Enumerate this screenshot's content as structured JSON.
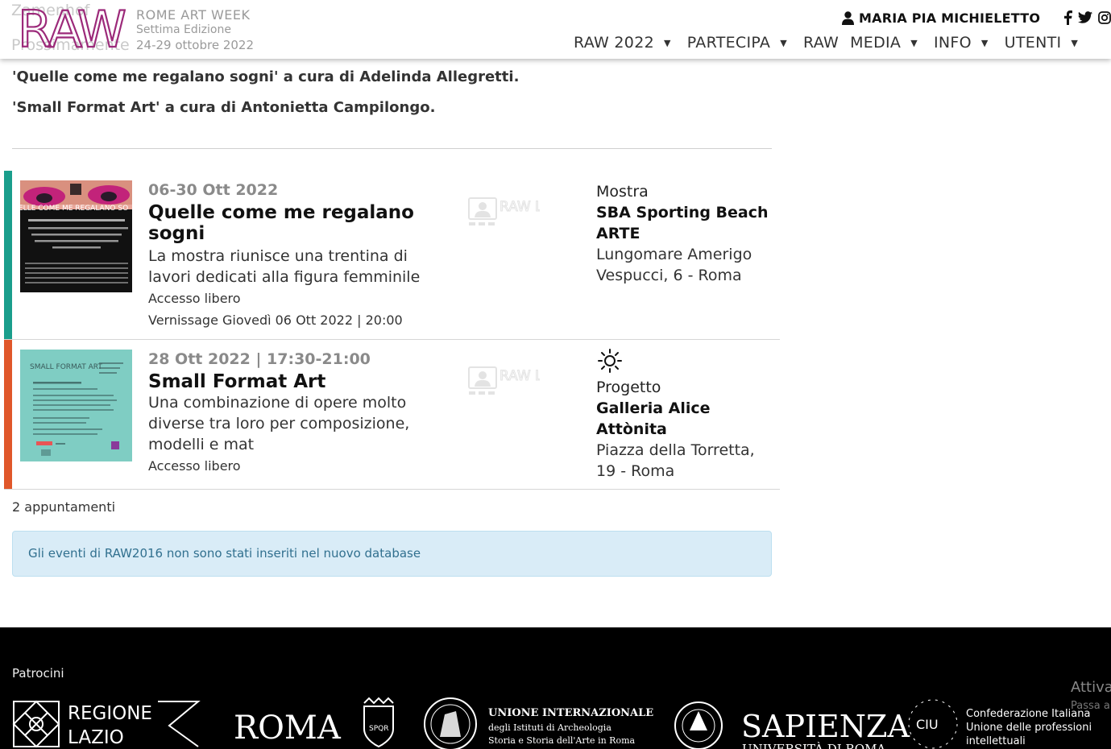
{
  "header": {
    "ghost_line1": "Zamenhof",
    "ghost_line2": "Prossimamente",
    "logo_text": "RAW",
    "brand_name": "ROME ART WEEK",
    "brand_edition": "Settima Edizione",
    "brand_dates": "24-29 ottobre 2022",
    "user_name": "MARIA PIA MICHIELETTO",
    "nav": [
      {
        "label": "RAW 2022",
        "caret": true
      },
      {
        "label": "PARTECIPA",
        "caret": true
      },
      {
        "label": "RAW",
        "caret": false
      },
      {
        "label": "MEDIA",
        "caret": true
      },
      {
        "label": "INFO",
        "caret": true
      },
      {
        "label": "UTENTI",
        "caret": true
      }
    ]
  },
  "curators": [
    "'Quelle come me regalano sogni' a cura di Adelinda Allegretti.",
    "'Small Format Art' a cura di Antonietta Campilongo."
  ],
  "events": [
    {
      "color": "#1a9e8c",
      "thumb_text": "ELLE COME ME REGALANO SO",
      "date": "06-30 Ott 2022",
      "title": "Quelle come me regalano sogni",
      "desc": "La mostra riunisce una trentina di lavori dedicati alla figura femminile",
      "access": "Accesso libero",
      "vernissage": "Vernissage Giovedì 06 Ott 2022 | 20:00",
      "type": "Mostra",
      "venue": "SBA Sporting Beach ARTE",
      "address": "Lungomare Amerigo Vespucci, 6 - Roma",
      "live_label": "RAW LIVE"
    },
    {
      "color": "#e0572a",
      "thumb_text": "SMALL FORMAT ART",
      "date": "28 Ott 2022 | 17:30-21:00",
      "title": "Small Format Art",
      "desc": "Una combinazione di opere molto diverse tra loro per composizione, modelli e mat",
      "access": "Accesso libero",
      "type": "Progetto",
      "venue": "Galleria Alice Attònita",
      "address": "Piazza della Torretta, 19 - Roma",
      "live_label": "RAW LIVE"
    }
  ],
  "count_text": "2 appuntamenti",
  "alert_text": "Gli eventi di RAW2016 non sono stati inseriti nel nuovo database",
  "footer": {
    "patrocini": "Patrocini",
    "logos": {
      "lazio_1": "REGIONE",
      "lazio_2": "LAZIO",
      "roma": "ROMA",
      "uni_1": "UNIONE INTERNAZIONALE",
      "uni_2": "degli Istituti di Archeologia",
      "uni_3": "Storia e Storia dell'Arte in Roma",
      "sapienza_1": "SAPIENZA",
      "sapienza_2": "UNIVERSITÀ DI ROMA",
      "ciu_mark": "CIU",
      "ciu_1": "Confederazione Italiana",
      "ciu_2": "Unione delle professioni",
      "ciu_3": "intellettuali"
    },
    "activate_1": "Attiva",
    "activate_2": "Passa a"
  },
  "colors": {
    "brand_purple": "#9c2a7a",
    "alert_bg": "#d9ecf7",
    "alert_text": "#31708f"
  }
}
